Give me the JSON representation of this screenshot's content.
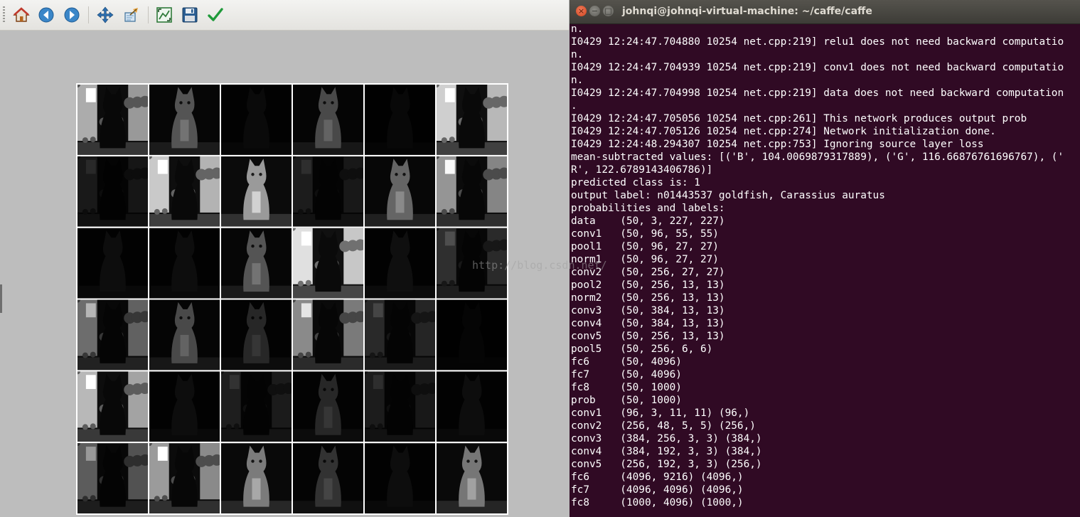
{
  "matplotlib": {
    "toolbar": {
      "home": "home-icon",
      "back": "back-arrow-icon",
      "forward": "forward-arrow-icon",
      "pan": "pan-cross-icon",
      "zoom": "zoom-rect-icon",
      "subplots": "subplots-config-icon",
      "save": "floppy-save-icon",
      "edit": "checkmark-edit-icon"
    },
    "figure": {
      "grid_rows": 6,
      "grid_cols": 6,
      "cell_brightness": [
        [
          0.6,
          0.3,
          0.08,
          0.26,
          0.06,
          0.72
        ],
        [
          0.18,
          0.7,
          0.55,
          0.2,
          0.36,
          0.52
        ],
        [
          0.1,
          0.1,
          0.3,
          0.78,
          0.12,
          0.34
        ],
        [
          0.38,
          0.26,
          0.14,
          0.48,
          0.3,
          0.04
        ],
        [
          0.64,
          0.1,
          0.22,
          0.14,
          0.2,
          0.1
        ],
        [
          0.32,
          0.54,
          0.44,
          0.18,
          0.1,
          0.42
        ]
      ],
      "cell_variant": [
        [
          "bright-rocks",
          "cat",
          "dark",
          "cat",
          "dark",
          "bright-rocks"
        ],
        [
          "dim-rocks",
          "bright-rocks",
          "cat",
          "dim-rocks",
          "cat",
          "bright-rocks"
        ],
        [
          "dark",
          "dark",
          "cat",
          "bright-rocks",
          "dark",
          "dim-rocks"
        ],
        [
          "bright-rocks",
          "cat",
          "cat",
          "bright-rocks",
          "dim-rocks",
          "dark"
        ],
        [
          "bright-rocks",
          "dark",
          "dim-rocks",
          "cat",
          "dim-rocks",
          "dark"
        ],
        [
          "bright-rocks",
          "bright-rocks",
          "cat",
          "cat",
          "dark",
          "cat"
        ]
      ]
    }
  },
  "terminal": {
    "title": "johnqi@johnqi-virtual-machine: ~/caffe/caffe",
    "lines": [
      "n.",
      "I0429 12:24:47.704880 10254 net.cpp:219] relu1 does not need backward computatio",
      "n.",
      "I0429 12:24:47.704939 10254 net.cpp:219] conv1 does not need backward computatio",
      "n.",
      "I0429 12:24:47.704998 10254 net.cpp:219] data does not need backward computation",
      ".",
      "I0429 12:24:47.705056 10254 net.cpp:261] This network produces output prob",
      "I0429 12:24:47.705126 10254 net.cpp:274] Network initialization done.",
      "I0429 12:24:48.294307 10254 net.cpp:753] Ignoring source layer loss",
      "mean-subtracted values: [('B', 104.0069879317889), ('G', 116.66876761696767), ('",
      "R', 122.6789143406786)]",
      "predicted class is: 1",
      "output label: n01443537 goldfish, Carassius auratus",
      "probabilities and labels:",
      "data    (50, 3, 227, 227)",
      "conv1   (50, 96, 55, 55)",
      "pool1   (50, 96, 27, 27)",
      "norm1   (50, 96, 27, 27)",
      "conv2   (50, 256, 27, 27)",
      "pool2   (50, 256, 13, 13)",
      "norm2   (50, 256, 13, 13)",
      "conv3   (50, 384, 13, 13)",
      "conv4   (50, 384, 13, 13)",
      "conv5   (50, 256, 13, 13)",
      "pool5   (50, 256, 6, 6)",
      "fc6     (50, 4096)",
      "fc7     (50, 4096)",
      "fc8     (50, 1000)",
      "prob    (50, 1000)",
      "conv1   (96, 3, 11, 11) (96,)",
      "conv2   (256, 48, 5, 5) (256,)",
      "conv3   (384, 256, 3, 3) (384,)",
      "conv4   (384, 192, 3, 3) (384,)",
      "conv5   (256, 192, 3, 3) (256,)",
      "fc6     (4096, 9216) (4096,)",
      "fc7     (4096, 4096) (4096,)",
      "fc8     (1000, 4096) (1000,)"
    ]
  },
  "watermark": "http://blog.csdn.net/"
}
